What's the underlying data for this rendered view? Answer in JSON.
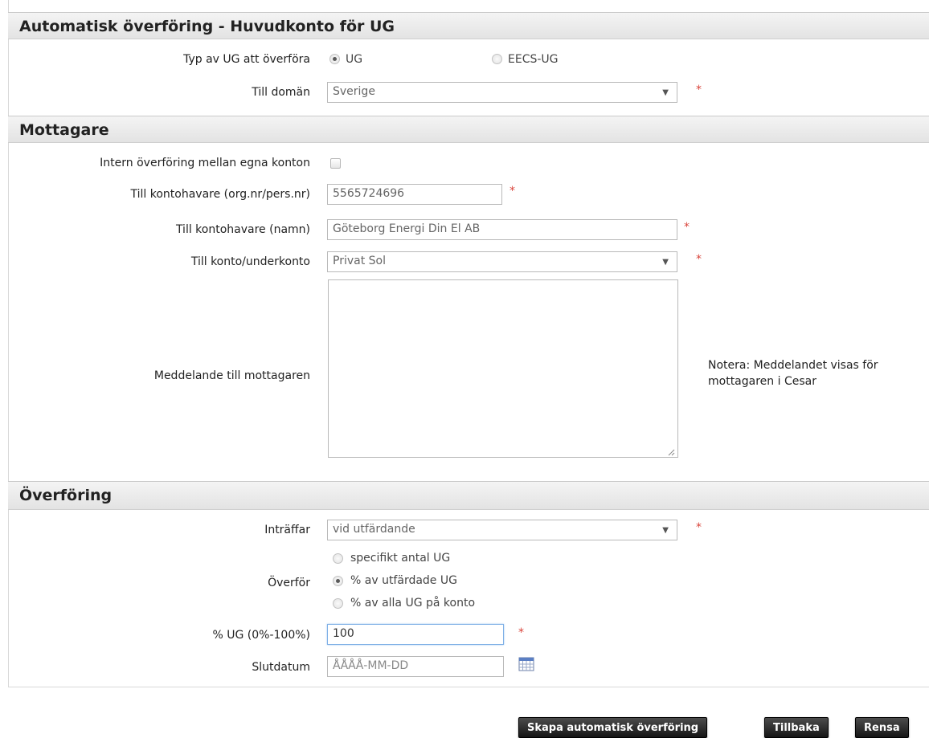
{
  "sections": {
    "auto_transfer": {
      "title": "Automatisk överföring - Huvudkonto för UG"
    },
    "recipient": {
      "title": "Mottagare"
    },
    "transfer": {
      "title": "Överföring"
    }
  },
  "fields": {
    "ug_type": {
      "label": "Typ av UG att överföra",
      "options": [
        "UG",
        "EECS-UG"
      ],
      "selected": "UG"
    },
    "to_domain": {
      "label": "Till domän",
      "value": "Sverige"
    },
    "internal_transfer": {
      "label": "Intern överföring mellan egna konton",
      "checked": false
    },
    "holder_org": {
      "label": "Till kontohavare (org.nr/pers.nr)",
      "value": "5565724696"
    },
    "holder_name": {
      "label": "Till kontohavare (namn)",
      "value": "Göteborg Energi Din El AB"
    },
    "to_account": {
      "label": "Till konto/underkonto",
      "value": "Privat Sol"
    },
    "message": {
      "label": "Meddelande till mottagaren",
      "value": "",
      "note": "Notera: Meddelandet visas för mottagaren i Cesar"
    },
    "occurs": {
      "label": "Inträffar",
      "value": "vid utfärdande"
    },
    "transfer_mode": {
      "label": "Överför",
      "options": [
        "specifikt antal UG",
        "% av utfärdade UG",
        "% av alla UG på konto"
      ],
      "selected": "% av utfärdade UG"
    },
    "percent": {
      "label": "% UG (0%-100%)",
      "value": "100"
    },
    "end_date": {
      "label": "Slutdatum",
      "placeholder": "ÅÅÅÅ-MM-DD"
    }
  },
  "required_marker": "*",
  "buttons": {
    "create": "Skapa automatisk överföring",
    "back": "Tillbaka",
    "clear": "Rensa"
  }
}
